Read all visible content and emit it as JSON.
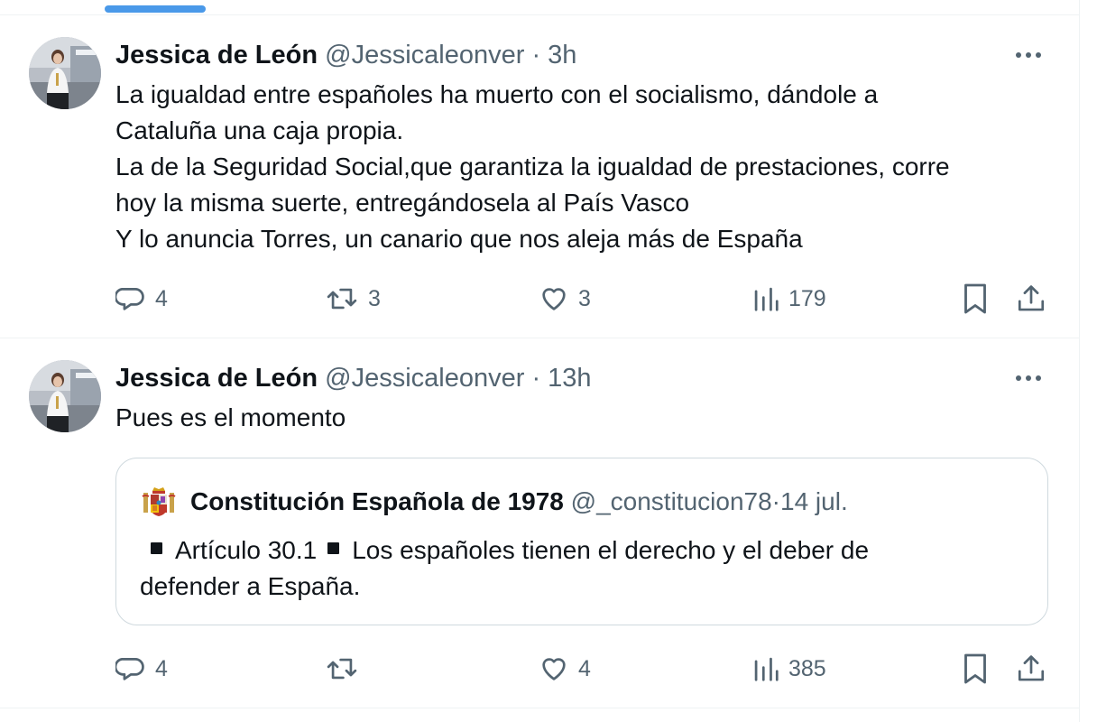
{
  "tweets": [
    {
      "author": {
        "name": "Jessica de León",
        "handle": "@Jessicaleonver"
      },
      "separator": " · ",
      "time": "3h",
      "body": [
        "La igualdad entre españoles ha muerto con el socialismo, dándole a",
        "Cataluña una caja propia.",
        "La de la Seguridad Social,que garantiza la igualdad de prestaciones, corre",
        "hoy la misma suerte, entregándosela al País Vasco",
        "Y lo anuncia Torres, un canario que nos aleja más de España"
      ],
      "stats": {
        "replies": "4",
        "retweets": "3",
        "likes": "3",
        "views": "179"
      }
    },
    {
      "author": {
        "name": "Jessica de León",
        "handle": "@Jessicaleonver"
      },
      "separator": " · ",
      "time": "13h",
      "body": [
        "Pues es el momento"
      ],
      "quote": {
        "emoji": "coat-of-arms-of-spain",
        "name": "Constitución Española de 1978",
        "handle": "@_constitucion78",
        "separator": " · ",
        "date": "14 jul.",
        "article": "Artículo 30.1",
        "text_line1": "Los españoles tienen el derecho y el deber de",
        "text_line2": "defender a España."
      },
      "stats": {
        "replies": "4",
        "retweets": "",
        "likes": "4",
        "views": "385"
      }
    }
  ],
  "icons": {
    "reply": "speech-bubble-icon",
    "retweet": "retweet-arrows-icon",
    "like": "heart-icon",
    "views": "bar-chart-icon",
    "bookmark": "bookmark-icon",
    "share": "upload-arrow-icon",
    "more": "three-dots-icon"
  },
  "colors": {
    "text_primary": "#0f1419",
    "text_secondary": "#536471",
    "divider": "#eff3f4",
    "quote_border": "#cfd9de",
    "tab_indicator": "#4a99e9"
  }
}
